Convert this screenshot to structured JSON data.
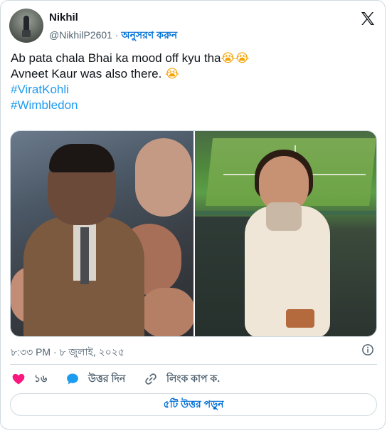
{
  "author": {
    "name": "Nikhil",
    "handle": "@NikhilP2601",
    "separator": " · ",
    "follow_label": "অনুসরণ করুন"
  },
  "tweet": {
    "lines": [
      "Ab pata chala Bhai ka mood off kyu tha",
      "Avneet Kaur was also there. "
    ],
    "line1_emoji": "😭😭",
    "line2_emoji": "😭",
    "hashtags": [
      "#ViratKohli",
      "#Wimbledon"
    ]
  },
  "media": {
    "left_image_name": "virat-kohli-photo",
    "right_image_name": "avneet-kaur-photo"
  },
  "timestamp": "৮:৩৩ PM · ৮ জুলাই, ২০২৫",
  "actions": {
    "like_count": "১৬",
    "reply_label": "উত্তর দিন",
    "copy_link_label": "লিংক কাপ ক."
  },
  "read_replies_label": "৫টি উত্তর পড়ুন",
  "icons": {
    "brand": "x-logo-icon",
    "info": "info-icon",
    "like": "heart-icon",
    "reply": "speech-bubble-icon",
    "copy": "link-icon"
  },
  "colors": {
    "like": "#f91880",
    "reply": "#1d9bf0",
    "hashtag": "#1d9bf0",
    "follow": "#006fd6",
    "muted": "#536471",
    "border": "#cfd9de"
  }
}
